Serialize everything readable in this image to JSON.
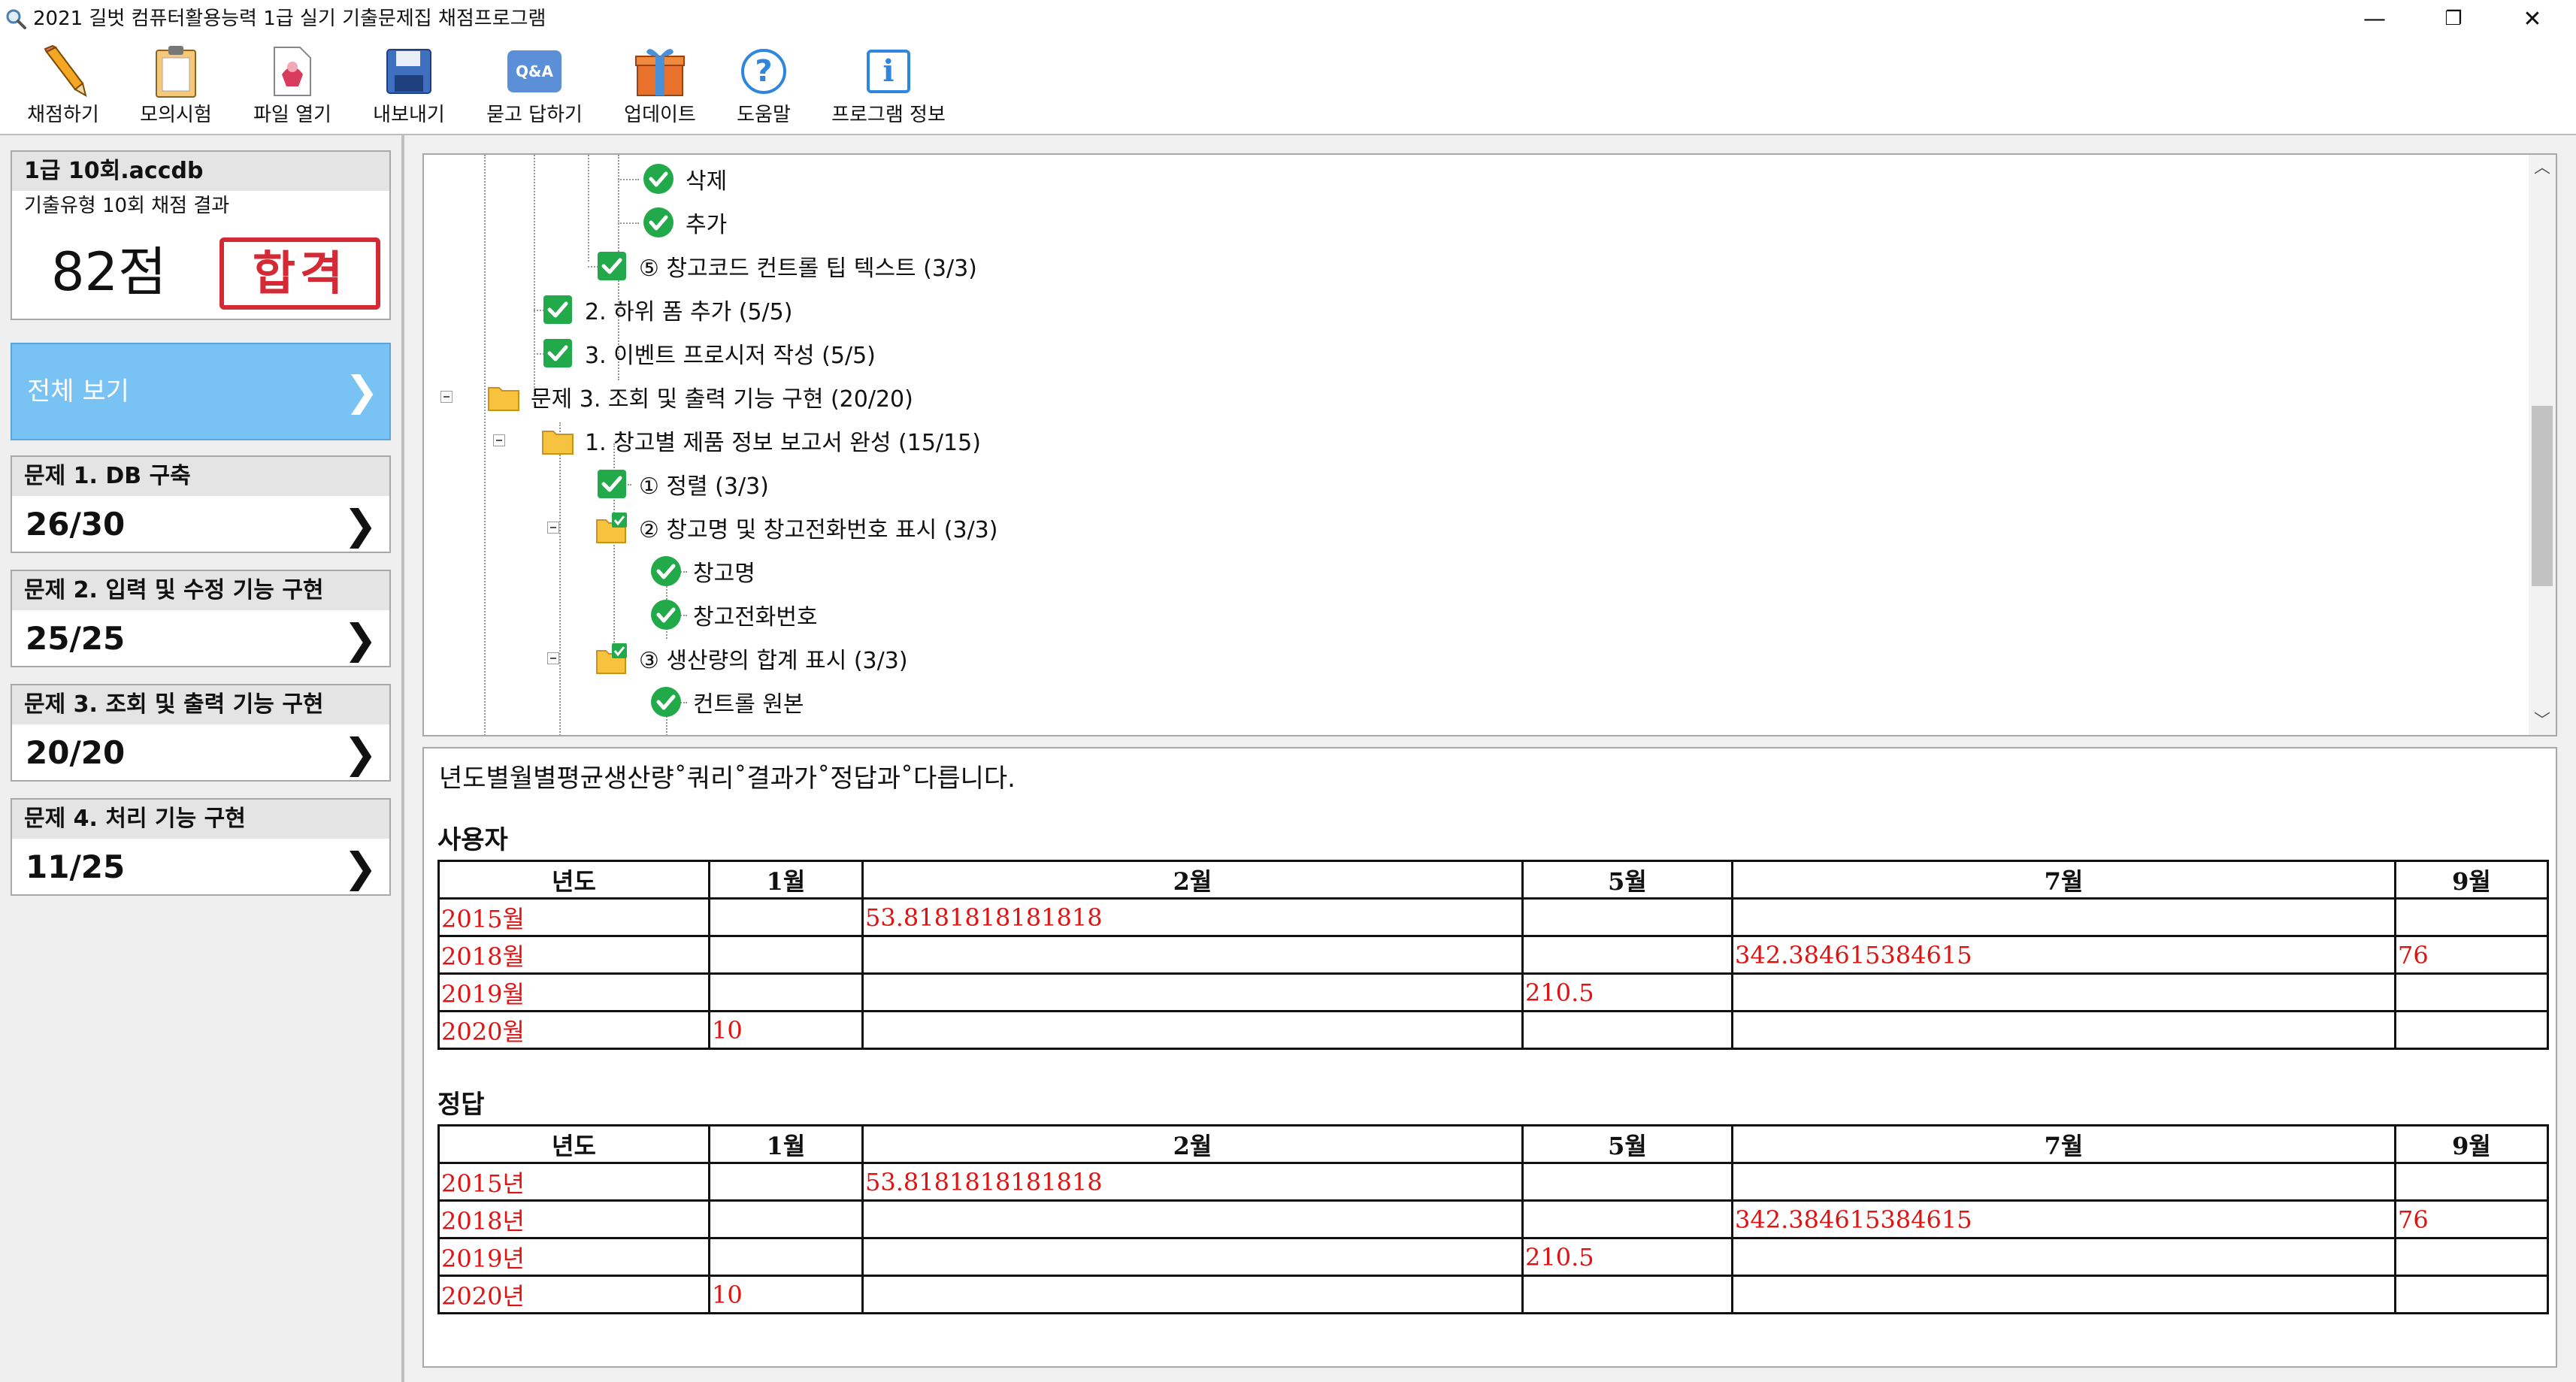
{
  "window": {
    "title": "2021 길벗 컴퓨터활용능력 1급 실기 기출문제집 채점프로그램",
    "minimize": "—",
    "restore": "❐",
    "close": "✕"
  },
  "toolbar": {
    "items": [
      {
        "label": "채점하기",
        "icon": "pencil-icon"
      },
      {
        "label": "모의시험",
        "icon": "clipboard-icon"
      },
      {
        "label": "파일 열기",
        "icon": "open-file-icon"
      },
      {
        "label": "내보내기",
        "icon": "save-disk-icon"
      },
      {
        "label": "묻고 답하기",
        "icon": "qa-bubble-icon",
        "badge": "Q&A"
      },
      {
        "label": "업데이트",
        "icon": "gift-box-icon"
      },
      {
        "label": "도움말",
        "icon": "help-icon",
        "glyph": "?"
      },
      {
        "label": "프로그램 정보",
        "icon": "info-icon",
        "glyph": "i"
      }
    ]
  },
  "result_card": {
    "filename": "1급 10회.accdb",
    "subtitle": "기출유형 10회 채점 결과",
    "score": "82점",
    "stamp": "합격",
    "stamp_color": "#d42a36"
  },
  "nav": {
    "view_all": "전체 보기",
    "chevron": "❯",
    "problems": [
      {
        "title": "문제 1. DB 구축",
        "score": "26/30"
      },
      {
        "title": "문제 2. 입력 및 수정 기능 구현",
        "score": "25/25"
      },
      {
        "title": "문제 3. 조회 및 출력 기능 구현",
        "score": "20/20"
      },
      {
        "title": "문제 4. 처리 기능 구현",
        "score": "11/25"
      }
    ]
  },
  "tree": {
    "nodes": [
      {
        "label": "삭제",
        "icon": "check-icon"
      },
      {
        "label": "추가",
        "icon": "check-icon"
      },
      {
        "label": "⑤ 창고코드 컨트롤 팁 텍스트 (3/3)",
        "icon": "check-icon"
      },
      {
        "label": "2. 하위 폼 추가 (5/5)",
        "icon": "check-icon"
      },
      {
        "label": "3. 이벤트 프로시저 작성 (5/5)",
        "icon": "check-icon"
      },
      {
        "label": "문제 3. 조회 및 출력 기능 구현 (20/20)",
        "icon": "folder-icon"
      },
      {
        "label": "1. 창고별 제품 정보 보고서 완성 (15/15)",
        "icon": "folder-icon"
      },
      {
        "label": "① 정렬 (3/3)",
        "icon": "check-icon"
      },
      {
        "label": "② 창고명 및 창고전화번호 표시 (3/3)",
        "icon": "folder-check-icon"
      },
      {
        "label": "창고명",
        "icon": "check-icon"
      },
      {
        "label": "창고전화번호",
        "icon": "check-icon"
      },
      {
        "label": "③ 생산량의 합계 표시 (3/3)",
        "icon": "folder-check-icon"
      },
      {
        "label": "컨트롤 원본",
        "icon": "check-icon"
      }
    ],
    "scroll_up": "︿",
    "scroll_down": "﹀"
  },
  "result": {
    "message": "년도별월별평균생산량˚쿼리˚결과가˚정답과˚다릅니다.",
    "user_title": "사용자",
    "answer_title": "정답",
    "columns": [
      "년도",
      "1월",
      "2월",
      "5월",
      "7월",
      "9월"
    ],
    "user_rows": [
      [
        "2015월",
        "",
        "53.8181818181818",
        "",
        "",
        ""
      ],
      [
        "2018월",
        "",
        "",
        "",
        "342.384615384615",
        "76"
      ],
      [
        "2019월",
        "",
        "",
        "210.5",
        "",
        ""
      ],
      [
        "2020월",
        "10",
        "",
        "",
        "",
        ""
      ]
    ],
    "answer_rows": [
      [
        "2015년",
        "",
        "53.8181818181818",
        "",
        "",
        ""
      ],
      [
        "2018년",
        "",
        "",
        "",
        "342.384615384615",
        "76"
      ],
      [
        "2019년",
        "",
        "",
        "210.5",
        "",
        ""
      ],
      [
        "2020년",
        "10",
        "",
        "",
        "",
        ""
      ]
    ],
    "mismatch_color": "#e01313"
  }
}
